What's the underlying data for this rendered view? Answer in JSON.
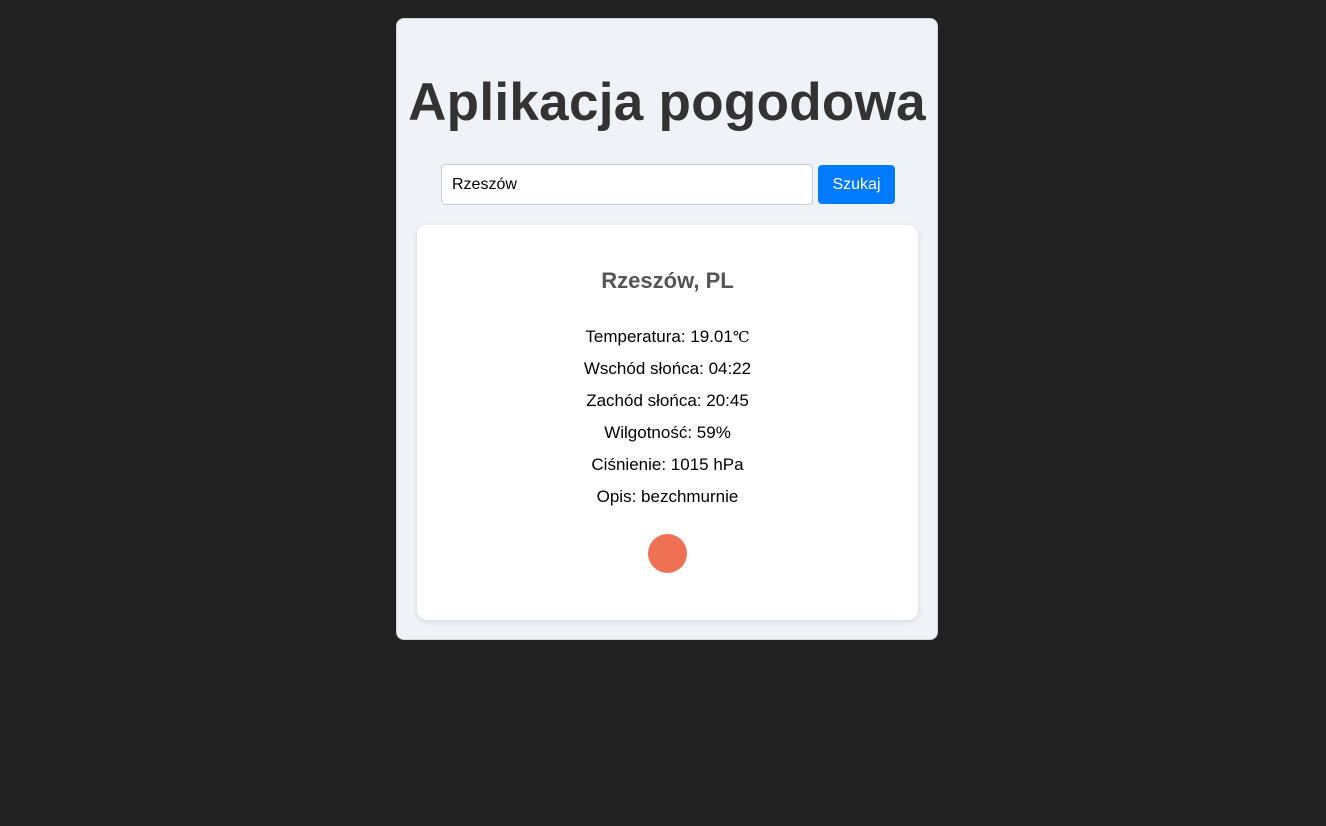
{
  "app": {
    "title": "Aplikacja pogodowa"
  },
  "search": {
    "value": "Rzeszów",
    "button_label": "Szukaj"
  },
  "weather": {
    "location": "Rzeszów, PL",
    "rows": [
      {
        "label": "Temperatura: ",
        "value": "19.01",
        "unit": "℃"
      },
      {
        "label": "Wschód słońca: ",
        "value": "04:22"
      },
      {
        "label": "Zachód słońca: ",
        "value": "20:45"
      },
      {
        "label": "Wilgotność: ",
        "value": "59%"
      },
      {
        "label": "Ciśnienie: ",
        "value": "1015 hPa"
      },
      {
        "label": "Opis: ",
        "value": "bezchmurnie"
      }
    ],
    "icon": "clear-sky-sun-icon"
  },
  "colors": {
    "page_background": "#222222",
    "app_background": "#eff2f7",
    "accent": "#007bff",
    "sun": "#ee7154"
  }
}
